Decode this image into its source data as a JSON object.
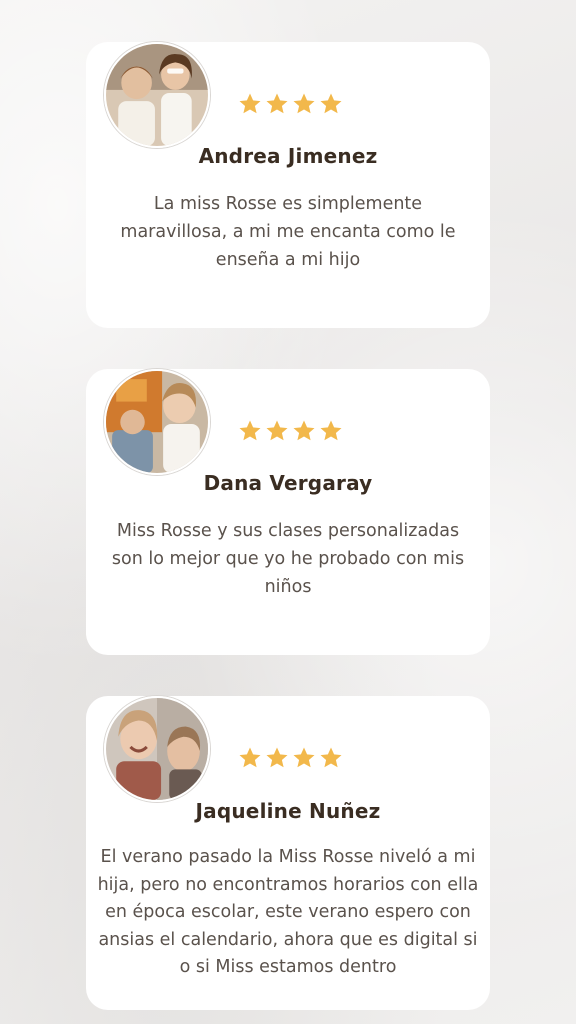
{
  "testimonials": [
    {
      "avatar": "child-photo-avatar",
      "rating": 4,
      "name": "Andrea Jimenez",
      "text": "La miss Rosse es simplemente maravillosa, a mi me encanta como le enseña a mi hijo"
    },
    {
      "avatar": "child-photo-avatar",
      "rating": 4,
      "name": "Dana Vergaray",
      "text": "Miss Rosse y sus clases personalizadas son lo mejor que yo he probado con mis niños"
    },
    {
      "avatar": "child-photo-avatar",
      "rating": 4,
      "name": "Jaqueline Nuñez",
      "text": "El verano pasado la Miss Rosse niveló a mi hija, pero no encontramos horarios con ella en época escolar, este verano espero con ansias el calendario, ahora que es digital si o si Miss estamos dentro"
    }
  ],
  "colors": {
    "star": "#f2b84b",
    "name": "#3a2d22",
    "text": "#5a524c",
    "card": "#ffffff"
  }
}
